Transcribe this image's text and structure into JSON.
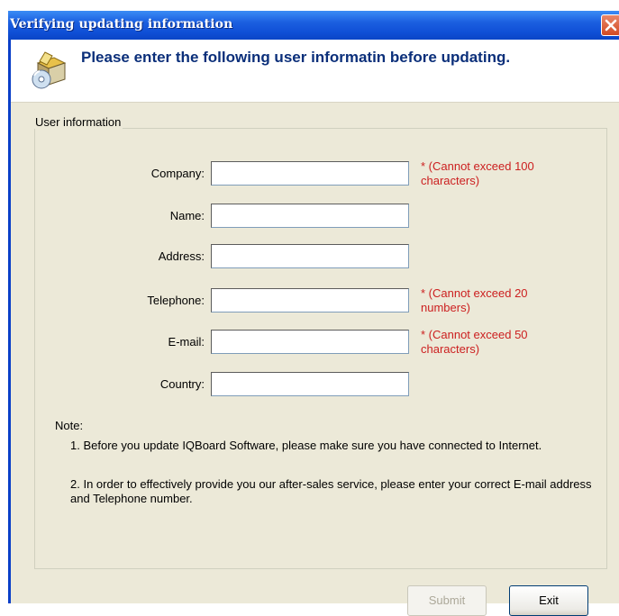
{
  "window": {
    "title": "Verifying updating information"
  },
  "header": {
    "message": "Please enter the following user informatin before updating."
  },
  "group": {
    "title": "User information"
  },
  "fields": [
    {
      "label": "Company:",
      "value": "",
      "hint": "* (Cannot exceed 100 characters)"
    },
    {
      "label": "Name:",
      "value": "",
      "hint": ""
    },
    {
      "label": "Address:",
      "value": "",
      "hint": ""
    },
    {
      "label": "Telephone:",
      "value": "",
      "hint": "* (Cannot exceed 20 numbers)"
    },
    {
      "label": "E-mail:",
      "value": "",
      "hint": "* (Cannot exceed 50 characters)"
    },
    {
      "label": "Country:",
      "value": "",
      "hint": ""
    }
  ],
  "notes": {
    "title": "Note:",
    "items": [
      "1. Before you update IQBoard Software, please make sure you have connected to Internet.",
      "2. In order to effectively provide you our after-sales service, please enter your correct E-mail address and Telephone number."
    ]
  },
  "buttons": {
    "submit": "Submit",
    "exit": "Exit"
  },
  "icons": {
    "close": "close-icon",
    "header": "setup-box-cd-icon"
  },
  "colors": {
    "titlebar": "#0a45c6",
    "hint": "#cc2020",
    "header_text": "#0b2f7a"
  }
}
